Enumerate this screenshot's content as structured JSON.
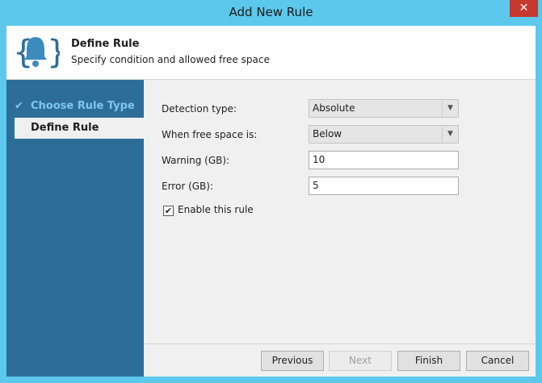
{
  "window": {
    "title": "Add New Rule",
    "close_glyph": "✕"
  },
  "header": {
    "title": "Define Rule",
    "subtitle": "Specify condition and allowed free space",
    "icon": "bell-braces-icon"
  },
  "sidebar": {
    "steps": [
      {
        "label": "Choose Rule Type",
        "state": "done"
      },
      {
        "label": "Define Rule",
        "state": "active"
      }
    ]
  },
  "form": {
    "detection_type": {
      "label": "Detection type:",
      "value": "Absolute"
    },
    "free_space": {
      "label": "When free space is:",
      "value": "Below"
    },
    "warning": {
      "label": "Warning (GB):",
      "value": "10"
    },
    "error": {
      "label": "Error (GB):",
      "value": "5"
    },
    "enable_rule": {
      "label": "Enable this rule",
      "checked": true
    }
  },
  "buttons": {
    "previous": "Previous",
    "next": "Next",
    "finish": "Finish",
    "cancel": "Cancel"
  },
  "colors": {
    "accent": "#5cc8ec",
    "sidebar": "#2d6e99",
    "close": "#c7382f"
  }
}
